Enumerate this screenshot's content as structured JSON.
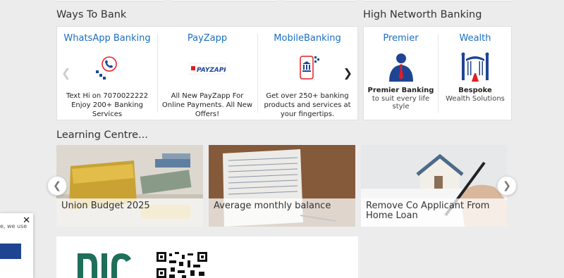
{
  "ways_to_bank": {
    "title": "Ways To Bank",
    "items": [
      {
        "title": "WhatsApp Banking",
        "icon": "whatsapp-phone-icon",
        "desc": "Text Hi on 7070022222 Enjoy 200+ Banking Services"
      },
      {
        "title": "PayZapp",
        "icon": "payzapp-logo",
        "logo_text": "PAYZAPP",
        "desc": "All New PayZapp For Online Payments. All New Offers!"
      },
      {
        "title": "MobileBanking",
        "icon": "mobile-bank-icon",
        "desc": "Get over 250+ banking products and services at your fingertips."
      }
    ]
  },
  "high_networth": {
    "title": "High Networth Banking",
    "items": [
      {
        "title": "Premier",
        "icon": "premier-person-icon",
        "name": "Premier Banking",
        "sub": "to suit every life style"
      },
      {
        "title": "Wealth",
        "icon": "wealth-gate-icon",
        "name": "Bespoke",
        "sub": "Wealth Solutions"
      }
    ]
  },
  "learning_centre": {
    "title": "Learning Centre...",
    "cards": [
      {
        "caption": "Union Budget 2025",
        "image": "union-budget-image"
      },
      {
        "caption": "Average monthly balance",
        "image": "bank-passbook-image"
      },
      {
        "caption": "Remove Co Applicant From Home Loan",
        "image": "home-loan-image"
      }
    ]
  },
  "popup": {
    "text": "e, we use"
  },
  "colors": {
    "link_blue": "#1a6ec2",
    "brand_navy": "#1f4592",
    "red": "#e31e24"
  }
}
